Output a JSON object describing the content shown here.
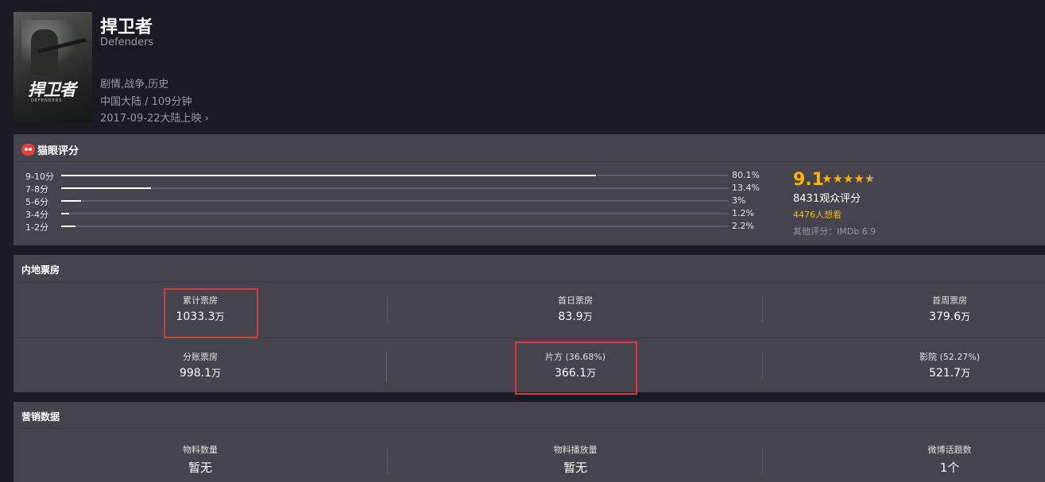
{
  "movie": {
    "title": "捍卫者",
    "english_title": "Defenders",
    "genres": "剧情,战争,历史",
    "region_duration": "中国大陆 / 109分钟",
    "release": "2017-09-22大陆上映 ›",
    "poster_text": "捍卫者",
    "poster_sub": "DEFENDERS"
  },
  "rating": {
    "section_title": "猫眼评分",
    "distribution": [
      {
        "label": "9-10分",
        "percent_text": "80.1%",
        "percent": 80.1
      },
      {
        "label": "7-8分",
        "percent_text": "13.4%",
        "percent": 13.4
      },
      {
        "label": "5-6分",
        "percent_text": "3%",
        "percent": 3
      },
      {
        "label": "3-4分",
        "percent_text": "1.2%",
        "percent": 1.2
      },
      {
        "label": "1-2分",
        "percent_text": "2.2%",
        "percent": 2.2
      }
    ],
    "score": "9.1",
    "stars": 4.5,
    "audience_count": "8431观众评分",
    "want_to_see": "4476人想看",
    "other_rating": "其他评分：IMDb 6.9"
  },
  "box_office": {
    "section_title": "内地票房",
    "cells": [
      {
        "label": "累计票房",
        "value": "1033.3",
        "unit": "万"
      },
      {
        "label": "首日票房",
        "value": "83.9",
        "unit": "万"
      },
      {
        "label": "首周票房",
        "value": "379.6",
        "unit": "万"
      },
      {
        "label": "分账票房",
        "value": "998.1",
        "unit": "万"
      },
      {
        "label": "片方 (36.68%)",
        "value": "366.1",
        "unit": "万"
      },
      {
        "label": "影院 (52.27%)",
        "value": "521.7",
        "unit": "万"
      }
    ]
  },
  "marketing": {
    "section_title": "营销数据",
    "cells": [
      {
        "label": "物料数量",
        "value": "暂无"
      },
      {
        "label": "物料播放量",
        "value": "暂无"
      },
      {
        "label": "微博话题数",
        "value": "1个"
      }
    ]
  },
  "colors": {
    "background": "#1b1a24",
    "panel": "#45434e",
    "accent_score": "#ffb400",
    "want_color": "#f5b623",
    "highlight_border": "#d63b3b"
  }
}
